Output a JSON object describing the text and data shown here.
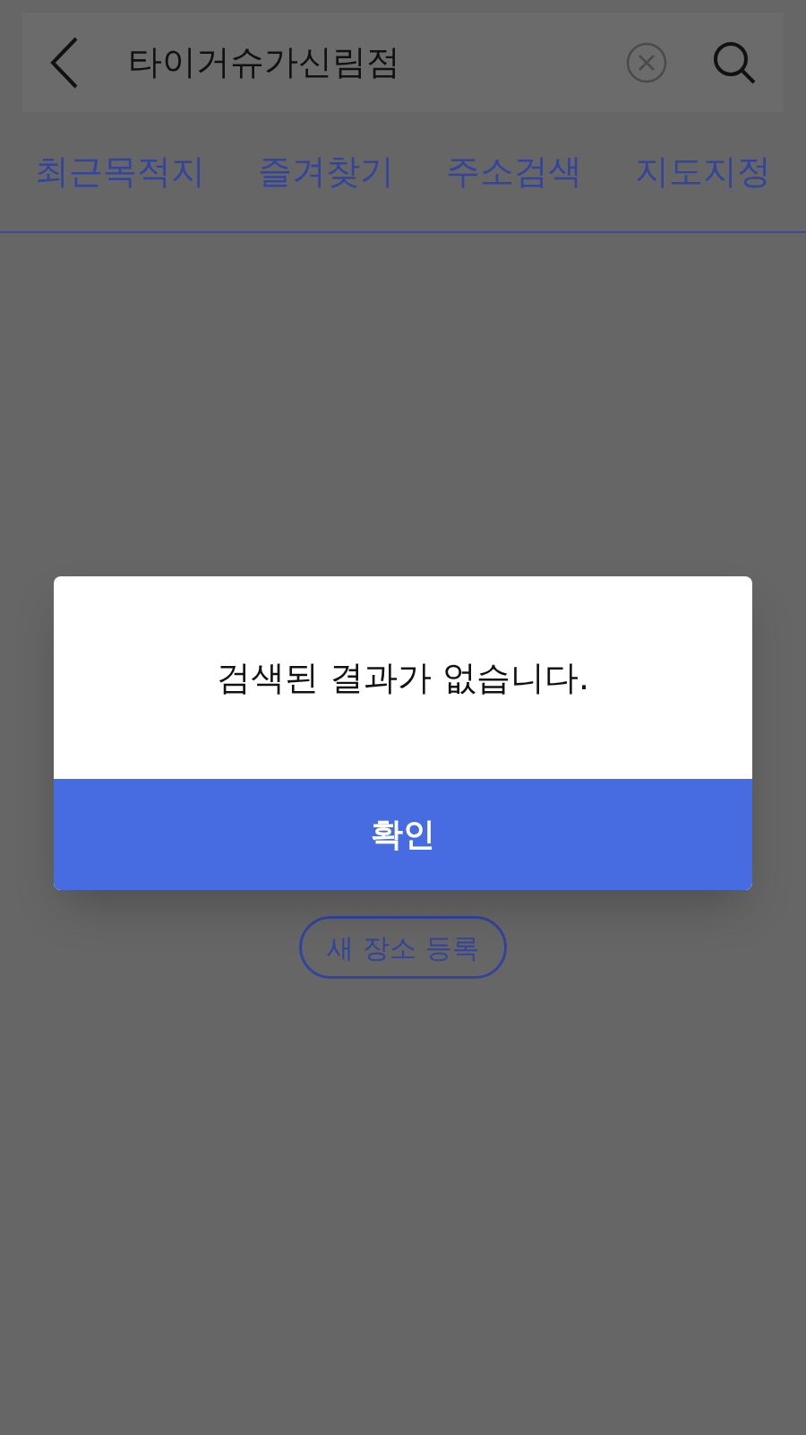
{
  "search": {
    "value": "타이거슈가신림점"
  },
  "tabs": [
    {
      "label": "최근목적지"
    },
    {
      "label": "즐겨찾기"
    },
    {
      "label": "주소검색"
    },
    {
      "label": "지도지정"
    }
  ],
  "register_button": "새 장소 등록",
  "dialog": {
    "message": "검색된 결과가 없습니다.",
    "confirm": "확인"
  }
}
